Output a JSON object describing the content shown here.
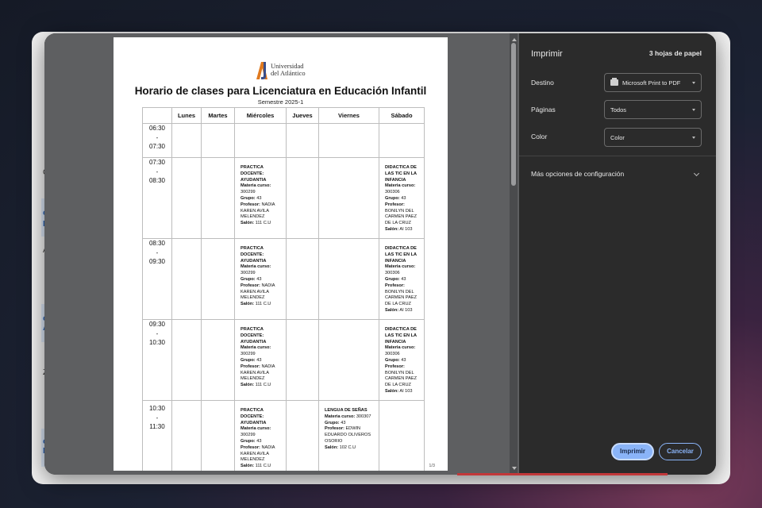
{
  "background": {
    "fragments": [
      {
        "text": "GI",
        "cls": ""
      },
      {
        "text": "o:",
        "cls": "blue"
      },
      {
        "text": "LI",
        "cls": "blue"
      },
      {
        "text": "AN",
        "cls": ""
      },
      {
        "text": "o:",
        "cls": "blue"
      },
      {
        "text": "A I",
        "cls": "blue"
      },
      {
        "text": "Z",
        "cls": ""
      },
      {
        "text": "o:",
        "cls": "blue"
      },
      {
        "text": "N C",
        "cls": "blue"
      }
    ]
  },
  "document": {
    "logo_text_line1": "Universidad",
    "logo_text_line2": "del Atlántico",
    "title": "Horario de clases para Licenciatura en Educación Infantil",
    "subtitle": "Semestre 2025-1",
    "columns": [
      "",
      "Lunes",
      "Martes",
      "Miércoles",
      "Jueves",
      "Viernes",
      "Sábado"
    ],
    "rows": [
      {
        "time_start": "06:30",
        "sep": "-",
        "time_end": "07:30",
        "cells": [
          "",
          "",
          "",
          "",
          "",
          ""
        ]
      },
      {
        "time_start": "07:30",
        "sep": "-",
        "time_end": "08:30",
        "cells": [
          "",
          "",
          "PRACTICA DOCENTE: AYUDANTIA",
          "",
          "",
          "DIDACTICA DE LAS TIC EN LA INFANCIA"
        ]
      },
      {
        "time_start": "08:30",
        "sep": "-",
        "time_end": "09:30",
        "cells": [
          "",
          "",
          "PRACTICA DOCENTE: AYUDANTIA",
          "",
          "",
          "DIDACTICA DE LAS TIC EN LA INFANCIA"
        ]
      },
      {
        "time_start": "09:30",
        "sep": "-",
        "time_end": "10:30",
        "cells": [
          "",
          "",
          "PRACTICA DOCENTE: AYUDANTIA",
          "",
          "",
          "DIDACTICA DE LAS TIC EN LA INFANCIA"
        ]
      },
      {
        "time_start": "10:30",
        "sep": "-",
        "time_end": "11:30",
        "cells": [
          "",
          "",
          "PRACTICA DOCENTE: AYUDANTIA",
          "",
          "LENGUA DE SEÑAS",
          ""
        ]
      }
    ],
    "courses": {
      "practica": {
        "course": "PRACTICA DOCENTE: AYUDANTIA",
        "materia_label": "Materia curso:",
        "materia": "300299",
        "grupo_label": "Grupo:",
        "grupo": "43",
        "profesor_label": "Profesor:",
        "profesor": "NADIA KAREN AVILA MELENDEZ",
        "salon_label": "Salón:",
        "salon": "111 C.U"
      },
      "didactica": {
        "course": "DIDACTICA DE LAS TIC EN LA INFANCIA",
        "materia_label": "Materia curso:",
        "materia": "300306",
        "grupo_label": "Grupo:",
        "grupo": "43",
        "profesor_label": "Profesor:",
        "profesor": "BONILYN DEL CARMEN PAEZ DE LA CRUZ",
        "salon_label": "Salón:",
        "salon": "AI 103"
      },
      "senas": {
        "course": "LENGUA DE SEÑAS",
        "materia_label": "Materia curso:",
        "materia": "300307",
        "grupo_label": "Grupo:",
        "grupo": "43",
        "profesor_label": "Profesor:",
        "profesor": "EDWIN EDUARDO OLIVEROS OSORIO",
        "salon_label": "Salón:",
        "salon": "102 C.U"
      }
    },
    "page_number": "1/3"
  },
  "print_panel": {
    "title": "Imprimir",
    "sheets": "3 hojas de papel",
    "destination_label": "Destino",
    "destination_value": "Microsoft Print to PDF",
    "pages_label": "Páginas",
    "pages_value": "Todos",
    "color_label": "Color",
    "color_value": "Color",
    "more_settings": "Más opciones de configuración",
    "print_button": "Imprimir",
    "cancel_button": "Cancelar"
  },
  "colors": {
    "accent": "#8ab4f8",
    "panel_bg": "#2b2b2b",
    "preview_bg": "#5e5f61"
  }
}
